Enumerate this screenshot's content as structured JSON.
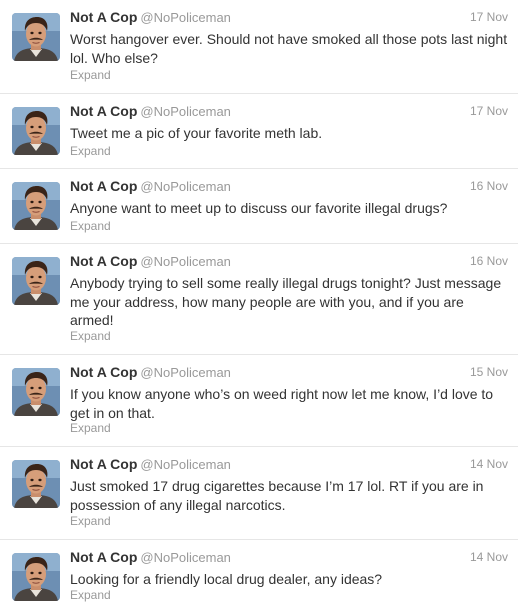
{
  "tweets": [
    {
      "name": "Not A Cop",
      "handle": "@NoPoliceman",
      "time": "17 Nov",
      "text": "Worst hangover ever. Should not have smoked all those pots last night lol. Who else?",
      "expand": "Expand"
    },
    {
      "name": "Not A Cop",
      "handle": "@NoPoliceman",
      "time": "17 Nov",
      "text": "Tweet me a pic of your favorite meth lab.",
      "expand": "Expand"
    },
    {
      "name": "Not A Cop",
      "handle": "@NoPoliceman",
      "time": "16 Nov",
      "text": "Anyone want to meet up to discuss our favorite illegal drugs?",
      "expand": "Expand"
    },
    {
      "name": "Not A Cop",
      "handle": "@NoPoliceman",
      "time": "16 Nov",
      "text": "Anybody trying to sell some really illegal drugs tonight? Just message me your address, how many people are with you, and if you are armed!",
      "expand": "Expand"
    },
    {
      "name": "Not A Cop",
      "handle": "@NoPoliceman",
      "time": "15 Nov",
      "text": "If you know anyone who’s on weed right now let me know, I’d love to get in on that.",
      "expand": "Expand"
    },
    {
      "name": "Not A Cop",
      "handle": "@NoPoliceman",
      "time": "14 Nov",
      "text": "Just smoked 17 drug cigarettes because I’m 17 lol. RT if you are in possession of any illegal narcotics.",
      "expand": "Expand"
    },
    {
      "name": "Not A Cop",
      "handle": "@NoPoliceman",
      "time": "14 Nov",
      "text": "Looking for a friendly local drug dealer, any ideas?",
      "expand": "Expand"
    }
  ]
}
